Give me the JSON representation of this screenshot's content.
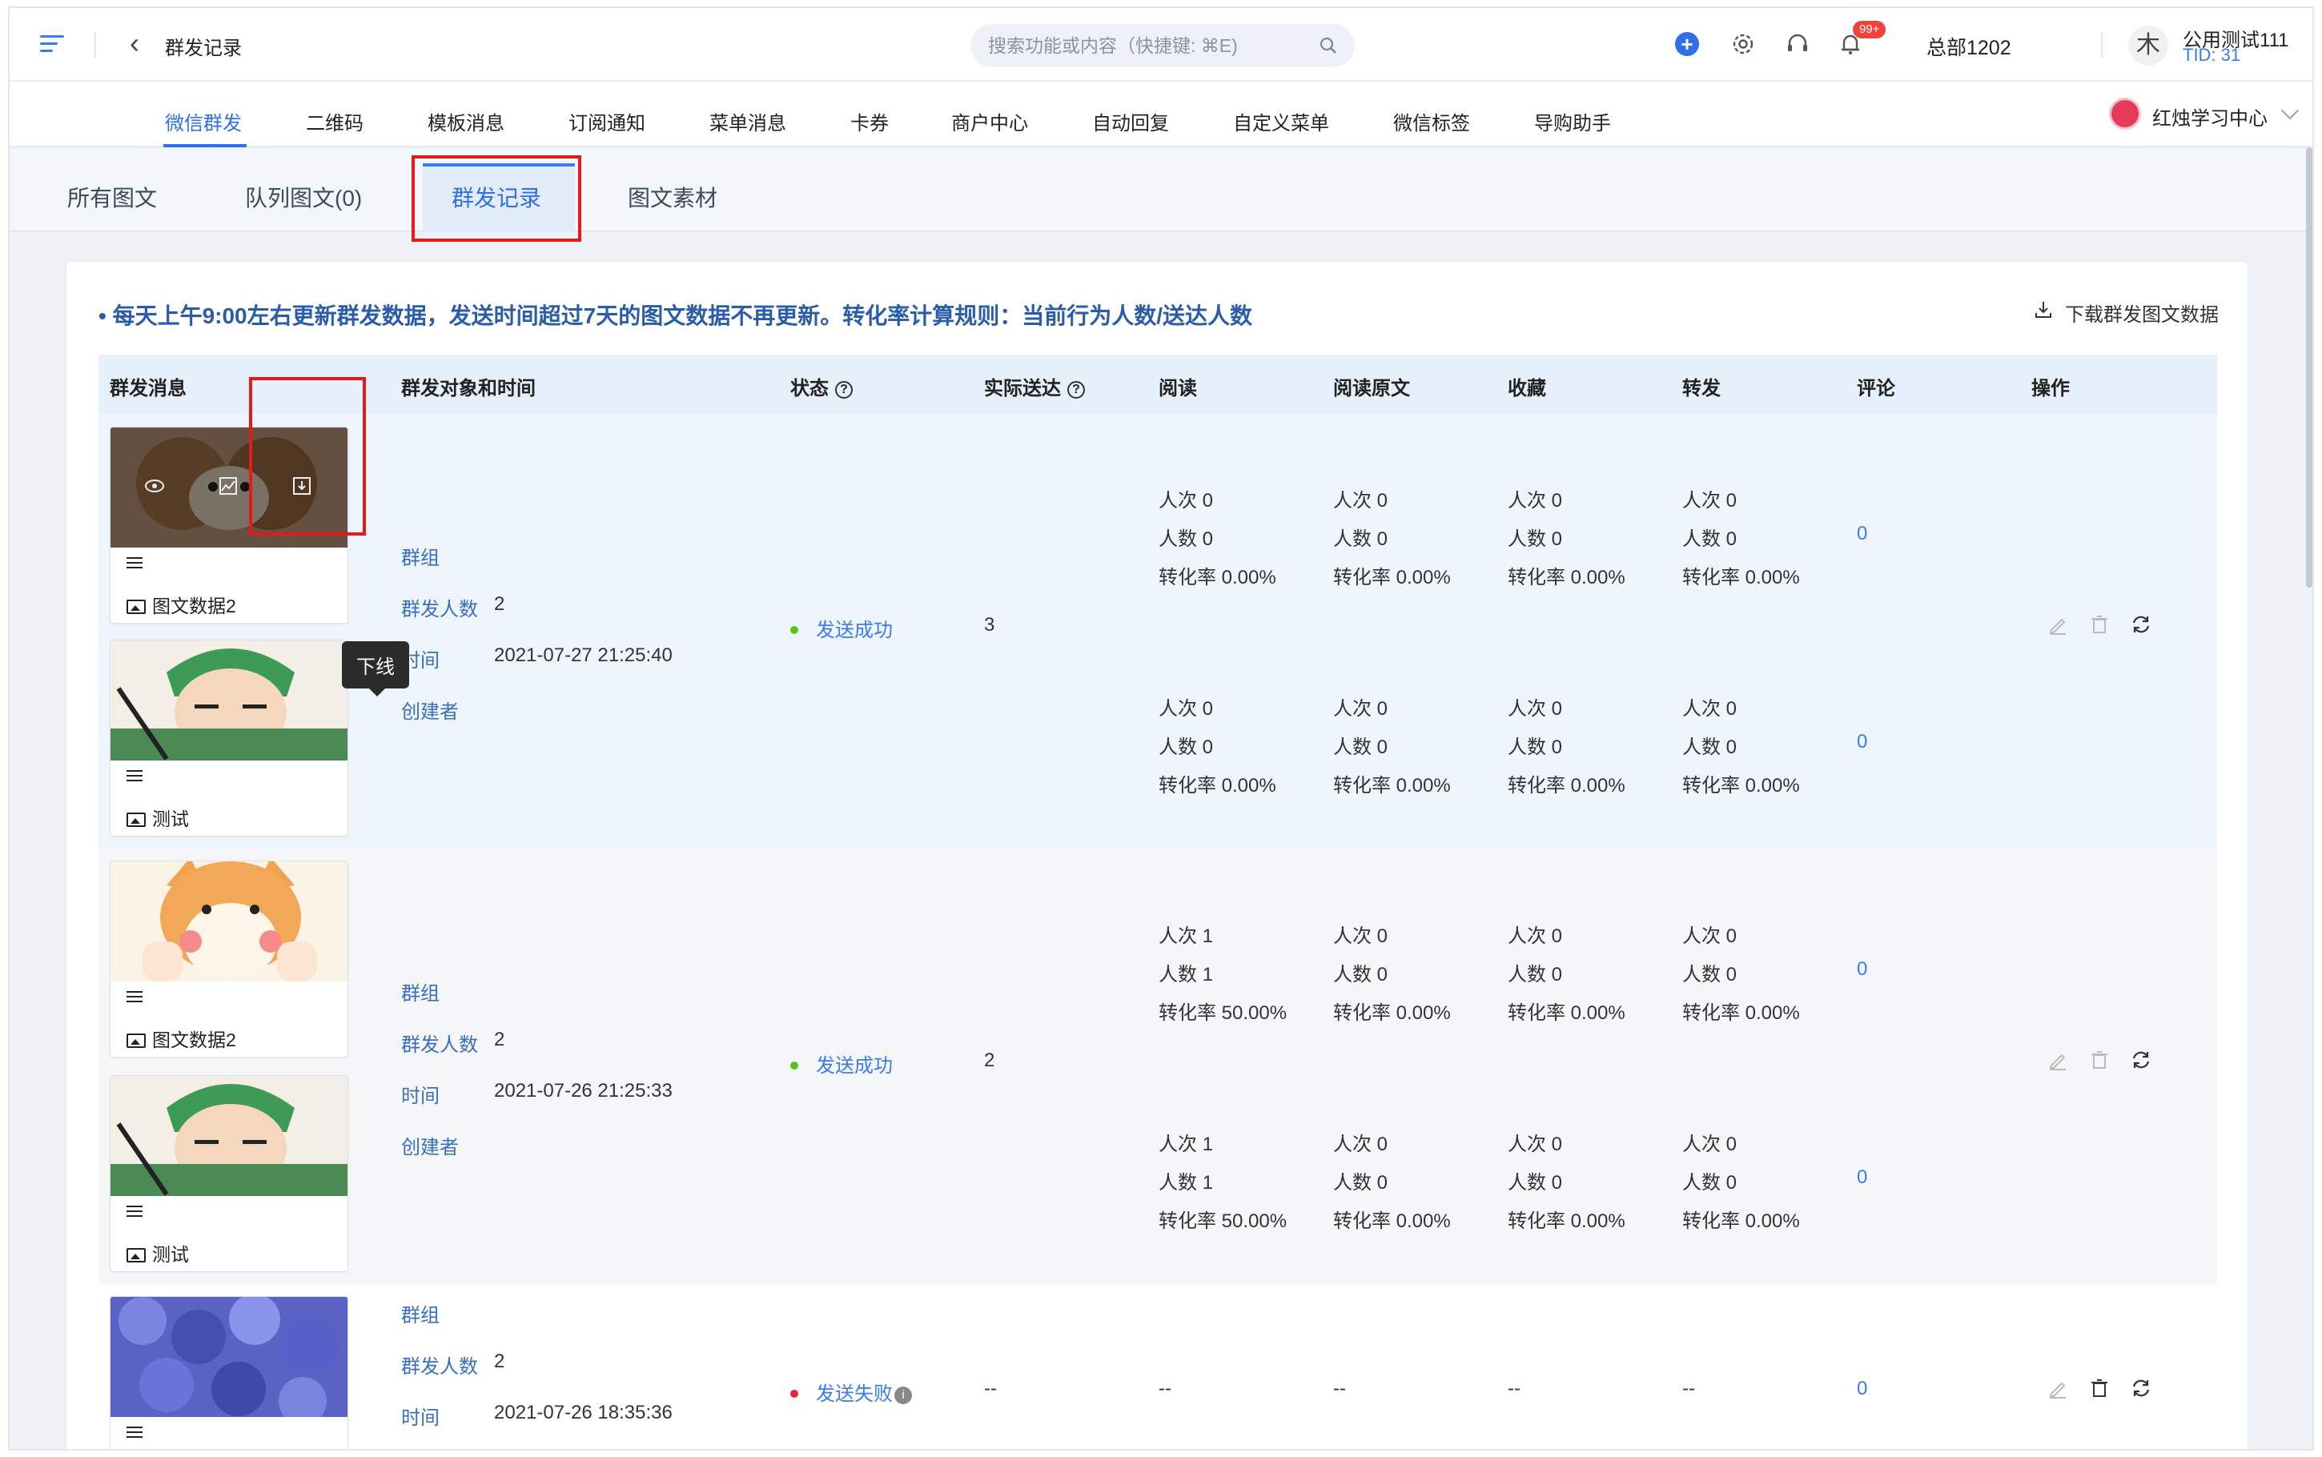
{
  "topbar": {
    "title": "群发记录",
    "search_placeholder": "搜索功能或内容（快捷键: ⌘E)",
    "notification_badge": "99+",
    "org": "总部1202",
    "avatar_char": "木",
    "user_name": "公用测试111",
    "user_tid": "TID: 31"
  },
  "nav": {
    "items": [
      "微信群发",
      "二维码",
      "模板消息",
      "订阅通知",
      "菜单消息",
      "卡券",
      "商户中心",
      "自动回复",
      "自定义菜单",
      "微信标签",
      "导购助手"
    ],
    "active_index": 0,
    "store_name": "红烛学习中心"
  },
  "subtabs": {
    "items": [
      "所有图文",
      "队列图文(0)",
      "群发记录",
      "图文素材"
    ],
    "active_index": 2
  },
  "notice": "• 每天上午9:00左右更新群发数据，发送时间超过7天的图文数据不再更新。转化率计算规则：当前行为人数/送达人数",
  "download_label": "下载群发图文数据",
  "table": {
    "headers": {
      "message": "群发消息",
      "target": "群发对象和时间",
      "status": "状态",
      "delivered": "实际送达",
      "read": "阅读",
      "read_original": "阅读原文",
      "favorite": "收藏",
      "forward": "转发",
      "comment": "评论",
      "action": "操作"
    },
    "meta_labels": {
      "group": "群组",
      "count": "群发人数",
      "time": "时间",
      "creator": "创建者"
    },
    "rows": [
      {
        "articles": [
          {
            "title": "图文数据2",
            "image": "dog-icon"
          },
          {
            "title": "测试",
            "image": "swordsman-icon"
          }
        ],
        "count": "2",
        "time": "2021-07-27 21:25:40",
        "status": "发送成功",
        "status_color": "#52c41a",
        "delivered": "3",
        "stats": [
          {
            "read": [
              "人次 0",
              "人数 0",
              "转化率 0.00%"
            ],
            "read_original": [
              "人次 0",
              "人数 0",
              "转化率 0.00%"
            ],
            "favorite": [
              "人次 0",
              "人数 0",
              "转化率 0.00%"
            ],
            "forward": [
              "人次 0",
              "人数 0",
              "转化率 0.00%"
            ],
            "comment": "0"
          },
          {
            "read": [
              "人次 0",
              "人数 0",
              "转化率 0.00%"
            ],
            "read_original": [
              "人次 0",
              "人数 0",
              "转化率 0.00%"
            ],
            "favorite": [
              "人次 0",
              "人数 0",
              "转化率 0.00%"
            ],
            "forward": [
              "人次 0",
              "人数 0",
              "转化率 0.00%"
            ],
            "comment": "0"
          }
        ]
      },
      {
        "articles": [
          {
            "title": "图文数据2",
            "image": "shiba-icon"
          },
          {
            "title": "测试",
            "image": "swordsman-icon"
          }
        ],
        "count": "2",
        "time": "2021-07-26 21:25:33",
        "status": "发送成功",
        "status_color": "#52c41a",
        "delivered": "2",
        "stats": [
          {
            "read": [
              "人次 1",
              "人数 1",
              "转化率 50.00%"
            ],
            "read_original": [
              "人次 0",
              "人数 0",
              "转化率 0.00%"
            ],
            "favorite": [
              "人次 0",
              "人数 0",
              "转化率 0.00%"
            ],
            "forward": [
              "人次 0",
              "人数 0",
              "转化率 0.00%"
            ],
            "comment": "0"
          },
          {
            "read": [
              "人次 1",
              "人数 1",
              "转化率 50.00%"
            ],
            "read_original": [
              "人次 0",
              "人数 0",
              "转化率 0.00%"
            ],
            "favorite": [
              "人次 0",
              "人数 0",
              "转化率 0.00%"
            ],
            "forward": [
              "人次 0",
              "人数 0",
              "转化率 0.00%"
            ],
            "comment": "0"
          }
        ]
      },
      {
        "articles": [
          {
            "title": "",
            "image": "hydrangea-icon"
          }
        ],
        "count": "2",
        "time": "2021-07-26 18:35:36",
        "status": "发送失败",
        "status_color": "#f5222d",
        "delivered": "--",
        "placeholder": "--",
        "comment": "0"
      }
    ]
  },
  "tooltip": "下线"
}
